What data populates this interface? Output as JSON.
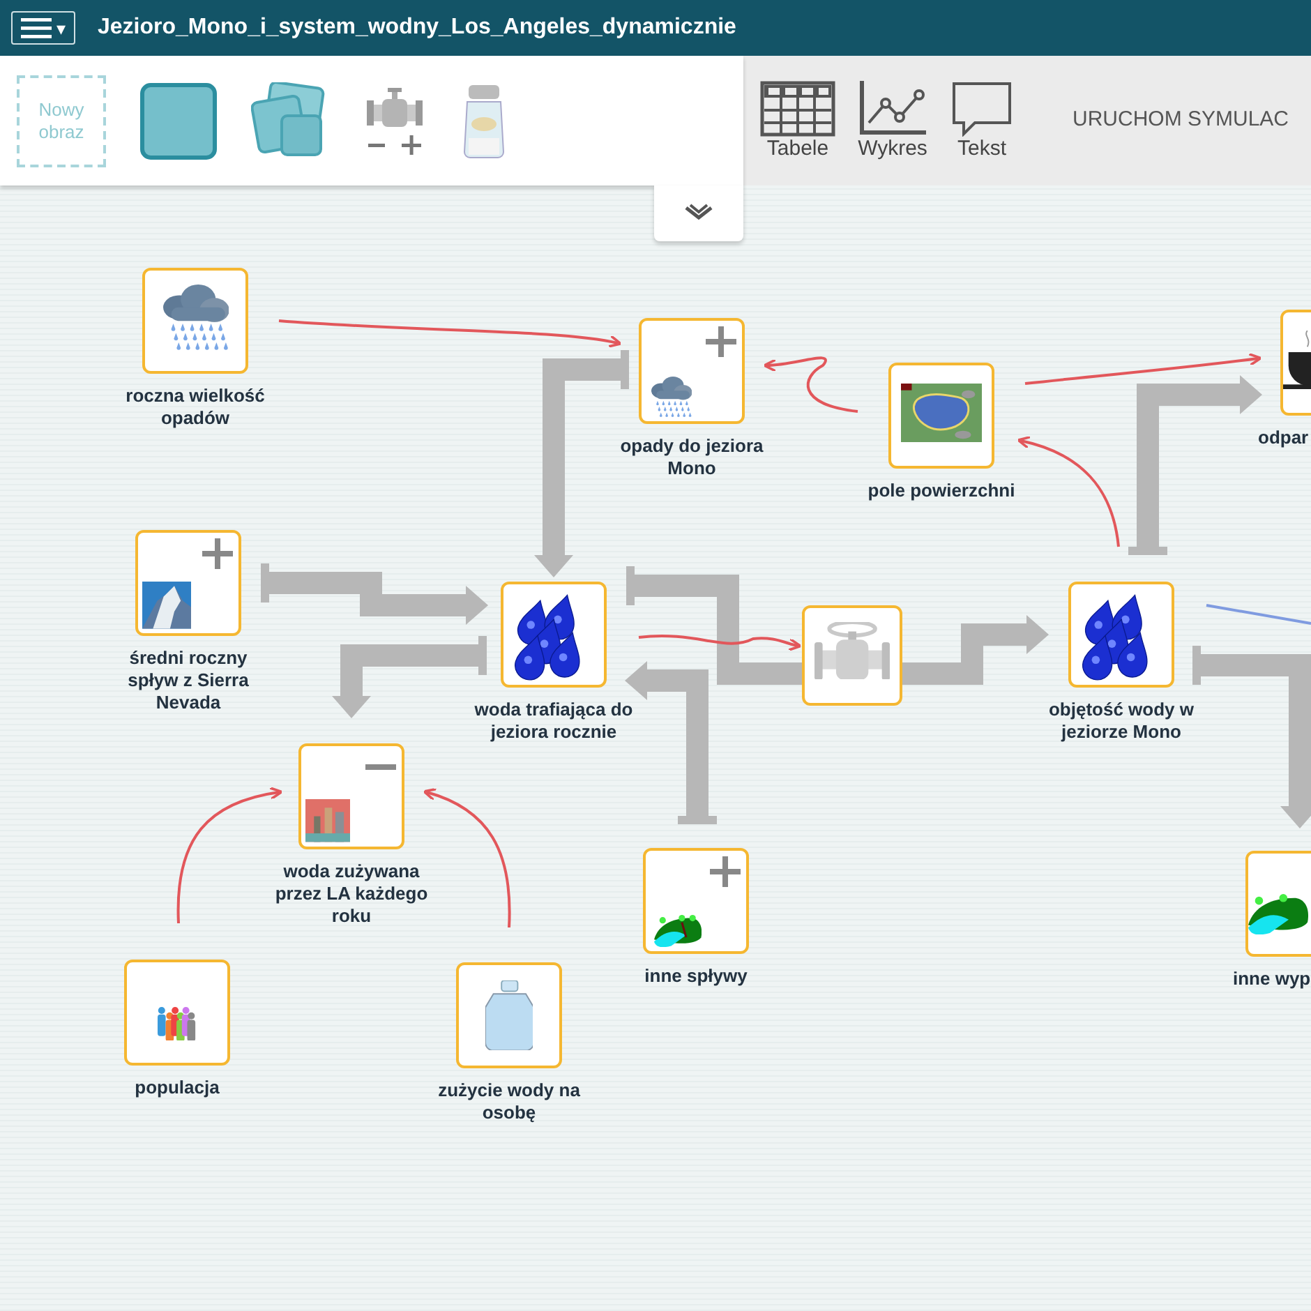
{
  "header": {
    "menu_caret": "▾",
    "title": "Jezioro_Mono_i_system_wodny_Los_Angeles_dynamicznie"
  },
  "palette": {
    "new_image": "Nowy obraz"
  },
  "views": [
    {
      "label": "Tabele"
    },
    {
      "label": "Wykres"
    },
    {
      "label": "Tekst"
    }
  ],
  "run_button": "URUCHOM SYMULAC",
  "nodes": [
    {
      "label": "roczna wielkość opadów",
      "kind": "variable"
    },
    {
      "label": "opady do jeziora Mono",
      "kind": "variable",
      "plus_marker": true
    },
    {
      "label": "pole powierzchni",
      "kind": "variable"
    },
    {
      "label": "odpar",
      "kind": "variable"
    },
    {
      "label": "średni roczny spływ z Sierra Nevada",
      "kind": "variable",
      "plus_marker": true
    },
    {
      "label": "woda trafiająca do jeziora rocznie",
      "kind": "stock"
    },
    {
      "kind": "flow"
    },
    {
      "label": "objętość wody w jeziorze Mono",
      "kind": "stock"
    },
    {
      "label": "woda zużywana przez LA każdego roku",
      "kind": "variable",
      "minus_marker": true
    },
    {
      "label": "inne spływy",
      "kind": "variable",
      "plus_marker": true
    },
    {
      "label": "inne wyp",
      "kind": "variable"
    },
    {
      "label": "populacja",
      "kind": "variable"
    },
    {
      "label": "zużycie wody na osobę",
      "kind": "variable"
    }
  ]
}
